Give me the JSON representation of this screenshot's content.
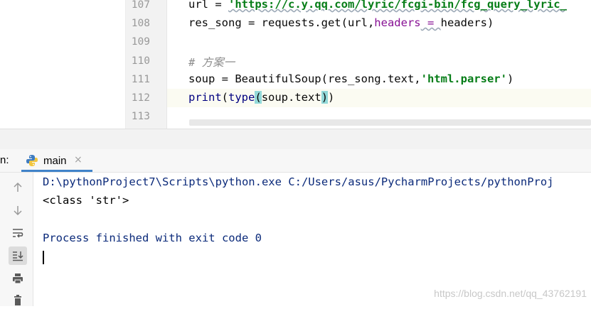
{
  "editor": {
    "lines": [
      {
        "num": "107",
        "current": false,
        "tokens": [
          {
            "t": "url = ",
            "c": ""
          },
          {
            "t": "'https://c.y.qq.com/lyric/fcgi-bin/fcg_query_lyric_",
            "c": "str-u"
          }
        ]
      },
      {
        "num": "108",
        "current": false,
        "tokens": [
          {
            "t": "res_song = requests.get(url,",
            "c": ""
          },
          {
            "t": "headers",
            "c": "kw"
          },
          {
            "t": " = ",
            "c": "kw-u"
          },
          {
            "t": "headers)",
            "c": ""
          }
        ]
      },
      {
        "num": "109",
        "current": false,
        "tokens": []
      },
      {
        "num": "110",
        "current": false,
        "tokens": [
          {
            "t": "# 方案一",
            "c": "cm"
          }
        ]
      },
      {
        "num": "111",
        "current": false,
        "tokens": [
          {
            "t": "soup = BeautifulSoup(res_song.text,",
            "c": ""
          },
          {
            "t": "'html.parser'",
            "c": "str"
          },
          {
            "t": ")",
            "c": ""
          }
        ]
      },
      {
        "num": "112",
        "current": true,
        "tokens": [
          {
            "t": "print",
            "c": "fn"
          },
          {
            "t": "(",
            "c": ""
          },
          {
            "t": "type",
            "c": "fn"
          },
          {
            "t": "(",
            "c": "par"
          },
          {
            "t": "soup.text",
            "c": ""
          },
          {
            "t": ")",
            "c": "par"
          },
          {
            "t": ")",
            "c": ""
          }
        ]
      },
      {
        "num": "113",
        "current": false,
        "tokens": []
      }
    ]
  },
  "run_panel": {
    "label": "n:",
    "tab_label": "main",
    "tab_close": "×",
    "accent": "#4083c9"
  },
  "toolbar": {
    "icons": [
      "up-arrow-icon",
      "down-arrow-icon",
      "soft-wrap-icon",
      "scroll-to-end-icon",
      "print-icon",
      "trash-icon"
    ]
  },
  "console": {
    "cmd_line": "D:\\pythonProject7\\Scripts\\python.exe C:/Users/asus/PycharmProjects/pythonProj",
    "output_line": "<class 'str'>",
    "exit_line": "Process finished with exit code 0"
  },
  "watermark": "https://blog.csdn.net/qq_43762191"
}
